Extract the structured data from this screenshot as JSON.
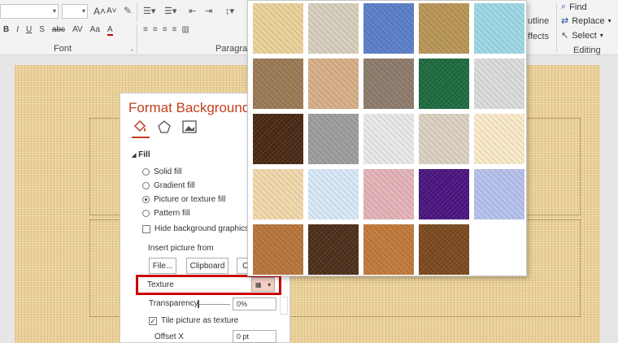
{
  "ribbon": {
    "groups": {
      "font": "Font",
      "paragraph": "Paragrap",
      "editing": "Editing"
    },
    "font_buttons": [
      "B",
      "I",
      "U",
      "S",
      "abc",
      "AV",
      "Aa",
      "A"
    ],
    "grow_font": "A˄",
    "shrink_font": "A˅",
    "partial_outline": "utline",
    "partial_effects": "ffects",
    "find": "Find",
    "replace": "Replace",
    "select": "Select"
  },
  "panel": {
    "title": "Format Background",
    "section": "Fill",
    "options": [
      {
        "label": "Solid fill",
        "selected": false
      },
      {
        "label": "Gradient fill",
        "selected": false
      },
      {
        "label": "Picture or texture fill",
        "selected": true
      },
      {
        "label": "Pattern fill",
        "selected": false
      }
    ],
    "hide_graphics": "Hide background graphics",
    "insert_from": "Insert picture from",
    "file_btn": "File...",
    "clipboard_btn": "Clipboard",
    "online_btn": "O",
    "texture_label": "Texture",
    "transparency_label": "Transparency",
    "transparency_value": "0%",
    "transparency_level": 0,
    "tile_label": "Tile picture as texture",
    "tile_checked": true,
    "offset_x_label": "Offset X",
    "offset_x_value": "0 pt"
  },
  "textures": [
    "#ecd29a",
    "#d8cfbd",
    "#5b7fc9",
    "#b99656",
    "#9ed8e6",
    "#9b7b55",
    "#d8b088",
    "#8e7c6d",
    "#1d6b3f",
    "#dcdcdc",
    "#4a2914",
    "#9e9e9e",
    "#e9e9e9",
    "#dcd2c2",
    "#fbebc9",
    "#f2d9ad",
    "#d9e9f8",
    "#e4b4b8",
    "#4b1580",
    "#b7c2ec",
    "#b7763c",
    "#4d2f1a",
    "#c27a3b",
    "#7b4a1f"
  ],
  "colors": {
    "accent": "#c43e1c",
    "highlight": "#cc0000",
    "slide_bg": "#e9cf97"
  }
}
